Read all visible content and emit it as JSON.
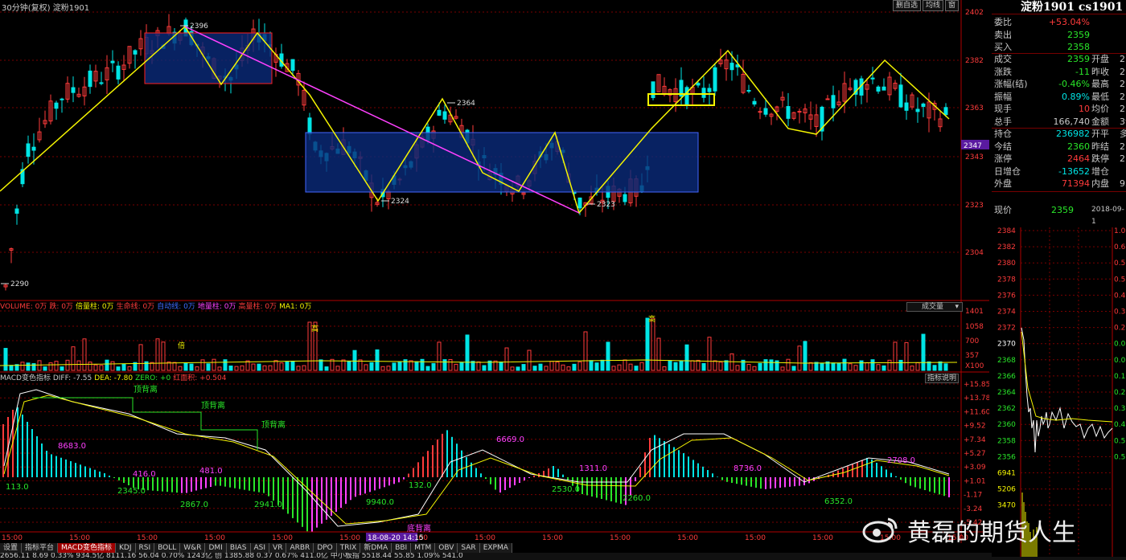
{
  "header": {
    "title": "30分钟(复权) 淀粉1901",
    "buttons": [
      "删自选",
      "均线",
      "窗"
    ]
  },
  "colors": {
    "up": "#ff3b3b",
    "down": "#00e5e5",
    "grid": "#7a0000",
    "axis": "#b00000",
    "trend": "#f5f500",
    "channel": "#ff40ff",
    "box": "#0a2a7a"
  },
  "price_axis": [
    "2402",
    "2382",
    "2363",
    "2343",
    "2323",
    "2304"
  ],
  "current_price_tag": "2347",
  "price_annotations": [
    "2396",
    "2290",
    "2364",
    "2324",
    "2323"
  ],
  "volume": {
    "header": [
      {
        "text": "VOLUME: 0万",
        "color": "#ff3b3b"
      },
      {
        "text": "跌: 0万",
        "color": "#ff3b3b"
      },
      {
        "text": "倍量柱: 0万",
        "color": "#f5f500"
      },
      {
        "text": "生命线: 0万",
        "color": "#ff3b3b"
      },
      {
        "text": "自动线: 0万",
        "color": "#3b6bff"
      },
      {
        "text": "地量柱: 0万",
        "color": "#ff40ff"
      },
      {
        "text": "高量柱: 0万",
        "color": "#ff3b3b"
      },
      {
        "text": "MA1: 0万",
        "color": "#f5f500"
      }
    ],
    "dropdown": "成交量",
    "axis": [
      "1401",
      "1058",
      "700",
      "357",
      "X100"
    ],
    "badges": [
      "高",
      "倍",
      "高"
    ]
  },
  "macd": {
    "header": [
      {
        "text": "MACD变色指标 DIFF: -7.55",
        "color": "#c8c8c8"
      },
      {
        "text": "DEA: -7.80",
        "color": "#f5f500"
      },
      {
        "text": "ZERO: +0",
        "color": "#29e629"
      },
      {
        "text": "红面积: +0.504",
        "color": "#ff3b3b"
      }
    ],
    "help_button": "指标说明",
    "axis": [
      "+15.85",
      "+13.78",
      "+11.60",
      "+9.52",
      "+7.34",
      "+5.27",
      "+3.09",
      "+1.01",
      "-1.17",
      "-3.24",
      "-5.42"
    ],
    "labels": [
      {
        "text": "顶背离",
        "color": "#29e629"
      },
      {
        "text": "顶背离",
        "color": "#29e629"
      },
      {
        "text": "顶背离",
        "color": "#29e629"
      },
      {
        "text": "底背离",
        "color": "#ff40ff"
      },
      {
        "text": "8683.0",
        "color": "#ff40ff"
      },
      {
        "text": "416.0",
        "color": "#ff40ff"
      },
      {
        "text": "481.0",
        "color": "#ff40ff"
      },
      {
        "text": "6669.0",
        "color": "#ff40ff"
      },
      {
        "text": "1311.0",
        "color": "#ff40ff"
      },
      {
        "text": "8736.0",
        "color": "#ff40ff"
      },
      {
        "text": "2708.0",
        "color": "#ff40ff"
      },
      {
        "text": "113.0",
        "color": "#29e629"
      },
      {
        "text": "2345.0",
        "color": "#29e629"
      },
      {
        "text": "2867.0",
        "color": "#29e629"
      },
      {
        "text": "2941.0",
        "color": "#29e629"
      },
      {
        "text": "9940.0",
        "color": "#29e629"
      },
      {
        "text": "132.0",
        "color": "#29e629"
      },
      {
        "text": "2530.0",
        "color": "#29e629"
      },
      {
        "text": "2260.0",
        "color": "#29e629"
      },
      {
        "text": "6352.0",
        "color": "#29e629"
      }
    ]
  },
  "time_axis": [
    "15:00",
    "15:00",
    "15:00",
    "15:00",
    "15:00",
    "15:00",
    "15:00",
    "15:00",
    "15:00",
    "15:00",
    "15:00",
    "15:00",
    "15:00",
    "15:00",
    "15:00",
    "15:00"
  ],
  "time_marker": "18-08-20 14:15",
  "tabs": [
    "设置",
    "指标平台",
    "MACD变色指标",
    "KDJ",
    "RSI",
    "BOLL",
    "W&R",
    "DMI",
    "BIAS",
    "ASI",
    "VR",
    "ARBR",
    "DPO",
    "TRIX",
    "新DMA",
    "BBI",
    "MTM",
    "OBV",
    "SAR",
    "EXPMA"
  ],
  "status_bar": "2656.11     8.69     0.33%     934.5亿   8111.16    56.04    0.70%    1243亿   创   1385.88    0.37    0.67%   411.0亿   中小板指   5518.44   55.85   1.09%   541.0",
  "watermark": "黄磊的期货人生",
  "quote": {
    "title": "淀粉1901 cs1901",
    "rows_top": [
      {
        "label": "委比",
        "value": "+53.04%",
        "color": "#ff3b3b"
      },
      {
        "label": "卖出",
        "value": "2359",
        "color": "#29e629"
      },
      {
        "label": "买入",
        "value": "2358",
        "color": "#29e629"
      }
    ],
    "rows_mid": [
      {
        "label": "成交",
        "value": "2359",
        "color": "#29e629",
        "label2": "开盘",
        "value2": "2"
      },
      {
        "label": "涨跌",
        "value": "-11",
        "color": "#29e629",
        "label2": "昨收",
        "value2": "2"
      },
      {
        "label": "涨幅(结)",
        "value": "-0.46%",
        "color": "#29e629",
        "label2": "最高",
        "value2": "2"
      },
      {
        "label": "振幅",
        "value": "0.89%",
        "color": "#00e5e5",
        "label2": "最低",
        "value2": "2"
      },
      {
        "label": "现手",
        "value": "10",
        "color": "#ff3b3b",
        "label2": "均价",
        "value2": "2"
      },
      {
        "label": "总手",
        "value": "166,740",
        "color": "#c8c8c8",
        "label2": "金额",
        "value2": "39."
      }
    ],
    "rows_bot": [
      {
        "label": "持仓",
        "value": "236982",
        "color": "#00e5e5",
        "label2": "开平",
        "value2": "多"
      },
      {
        "label": "今结",
        "value": "2360",
        "color": "#29e629",
        "label2": "昨结",
        "value2": "2"
      },
      {
        "label": "涨停",
        "value": "2464",
        "color": "#ff3b3b",
        "label2": "跌停",
        "value2": "2"
      },
      {
        "label": "日增仓",
        "value": "-13652",
        "color": "#00e5e5",
        "label2": "增仓",
        "value2": ""
      },
      {
        "label": "外盘",
        "value": "71394",
        "color": "#ff3b3b",
        "label2": "内盘",
        "value2": "95"
      }
    ],
    "now_label": "现价",
    "now_value": "2359",
    "now_date": "2018-09-1",
    "mini_axis": [
      "2384",
      "2382",
      "2380",
      "2378",
      "2376",
      "2374",
      "2372",
      "2370",
      "2368",
      "2366",
      "2364",
      "2362",
      "2360",
      "2358",
      "2356",
      "6941",
      "5206",
      "3470"
    ],
    "mini_right": [
      "1.0",
      "0.6",
      "0.5",
      "0.5",
      "0.4",
      "0.3",
      "0.2",
      "0.0",
      "0.0",
      "0.1",
      "0.2",
      "0.3",
      "0.4",
      "0.5",
      "0.5"
    ]
  }
}
